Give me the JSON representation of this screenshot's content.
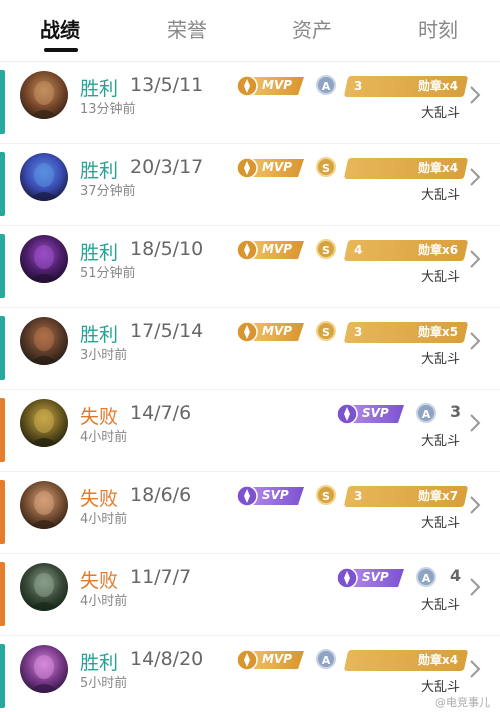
{
  "tabs": [
    "战绩",
    "荣誉",
    "资产",
    "时刻"
  ],
  "colors": {
    "win": "#27a9a0",
    "loss": "#e57e2a",
    "win_text": "#26a296",
    "loss_text": "#e07a2a"
  },
  "rows": [
    {
      "result": "胜利",
      "kda": "13/5/11",
      "time": "13分钟前",
      "mode": "大乱斗",
      "badge": "MVP",
      "grade": "A",
      "medal_left": "3",
      "medal_label": "勋章x4",
      "outcome": "win"
    },
    {
      "result": "胜利",
      "kda": "20/3/17",
      "time": "37分钟前",
      "mode": "大乱斗",
      "badge": "MVP",
      "grade": "S",
      "medal_left": "",
      "medal_label": "勋章x4",
      "outcome": "win"
    },
    {
      "result": "胜利",
      "kda": "18/5/10",
      "time": "51分钟前",
      "mode": "大乱斗",
      "badge": "MVP",
      "grade": "S",
      "medal_left": "4",
      "medal_label": "勋章x6",
      "outcome": "win"
    },
    {
      "result": "胜利",
      "kda": "17/5/14",
      "time": "3小时前",
      "mode": "大乱斗",
      "badge": "MVP",
      "grade": "S",
      "medal_left": "3",
      "medal_label": "勋章x5",
      "outcome": "win"
    },
    {
      "result": "失败",
      "kda": "14/7/6",
      "time": "4小时前",
      "mode": "大乱斗",
      "badge": "SVP",
      "grade": "A",
      "medal_left": "",
      "medal_label": "",
      "num_right": "3",
      "outcome": "loss"
    },
    {
      "result": "失败",
      "kda": "18/6/6",
      "time": "4小时前",
      "mode": "大乱斗",
      "badge": "SVP",
      "grade": "S",
      "medal_left": "3",
      "medal_label": "勋章x7",
      "outcome": "loss"
    },
    {
      "result": "失败",
      "kda": "11/7/7",
      "time": "4小时前",
      "mode": "大乱斗",
      "badge": "SVP",
      "grade": "A",
      "medal_left": "",
      "medal_label": "",
      "num_right": "4",
      "outcome": "loss"
    },
    {
      "result": "胜利",
      "kda": "14/8/20",
      "time": "5小时前",
      "mode": "大乱斗",
      "badge": "MVP",
      "grade": "A",
      "medal_left": "",
      "medal_label": "勋章x4",
      "outcome": "win"
    }
  ],
  "watermark": "@电竞事儿"
}
